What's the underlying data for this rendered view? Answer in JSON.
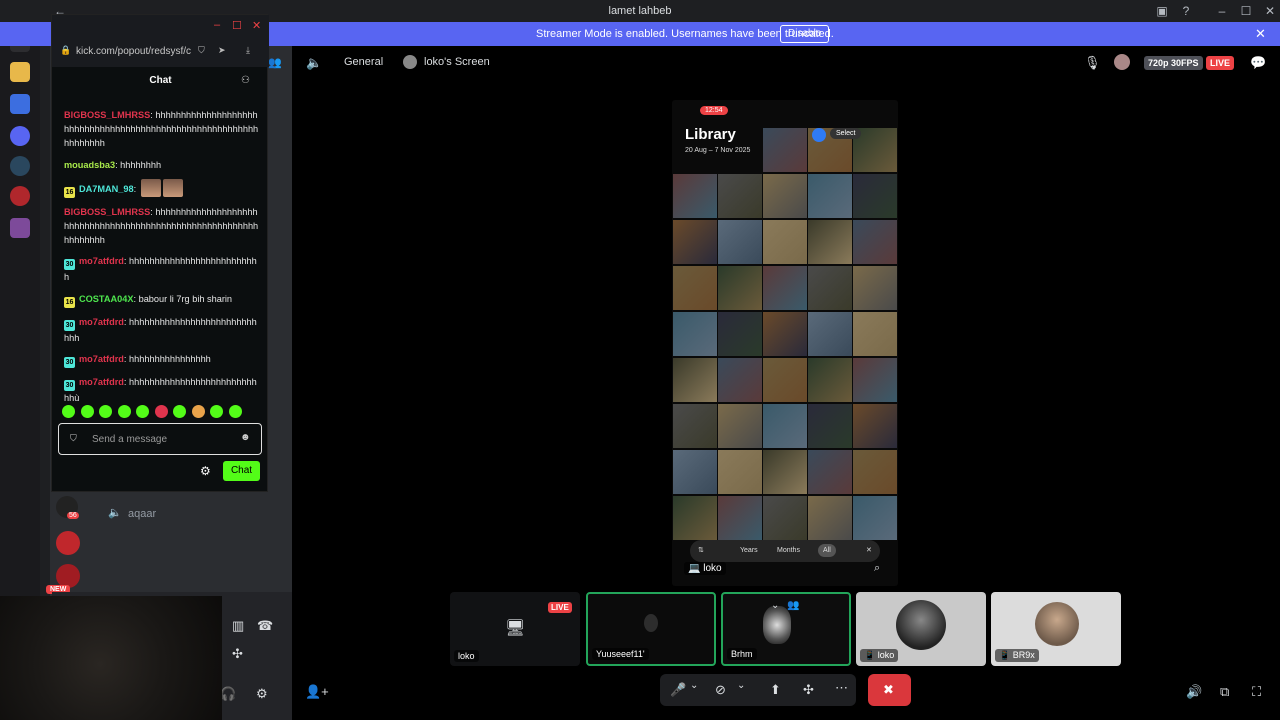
{
  "window": {
    "title": "lamet lahbeb"
  },
  "banner": {
    "text": "Streamer Mode is enabled. Usernames have been truncated.",
    "disable_label": "Disable"
  },
  "kick": {
    "url": "kick.com/popout/redsysf/c",
    "chat_title": "Chat",
    "messages": [
      {
        "user": "BIGBOSS_LMHRSS",
        "color": "#e0344d",
        "text": "hhhhhhhhhhhhhhhhhhhhhhhhhhhhhhhhhhhhhhhhhhhhhhhhhhhhhhhhhhhhhhhhhh"
      },
      {
        "user": "mouadsba3",
        "color": "#a8e94a",
        "text": "hhhhhhhh"
      },
      {
        "user": "DA7MAN_98",
        "color": "#4ee6d8",
        "badge": "16",
        "text": ""
      },
      {
        "user": "BIGBOSS_LMHRSS",
        "color": "#e0344d",
        "text": "hhhhhhhhhhhhhhhhhhhhhhhhhhhhhhhhhhhhhhhhhhhhhhhhhhhhhhhhhhhhhhhhhh"
      },
      {
        "user": "mo7atfdrd",
        "color": "#e0344d",
        "badge": "30",
        "text": "hhhhhhhhhhhhhhhhhhhhhhhhhh"
      },
      {
        "user": "COSTAA04X",
        "color": "#4ee64e",
        "badge": "16",
        "text": "babour li 7rg bih sharin"
      },
      {
        "user": "mo7atfdrd",
        "color": "#e0344d",
        "badge": "30",
        "text": "hhhhhhhhhhhhhhhhhhhhhhhhhhhh"
      },
      {
        "user": "mo7atfdrd",
        "color": "#e0344d",
        "badge": "30",
        "text": "hhhhhhhhhhhhhhhh"
      },
      {
        "user": "mo7atfdrd",
        "color": "#e0344d",
        "badge": "30",
        "text": "hhhhhhhhhhhhhhhhhhhhhhhhhhhù"
      }
    ],
    "send_placeholder": "Send a message",
    "chat_button": "Chat"
  },
  "voice": {
    "users": [
      "aqaar"
    ],
    "badge_count": "56",
    "new_label": "NEW"
  },
  "stage": {
    "channel": "General",
    "screen_title": "loko's Screen",
    "quality": "720p 30FPS",
    "live": "LIVE",
    "stream_owner": "loko",
    "phone": {
      "time": "12:54",
      "title": "Library",
      "date": "20 Aug – 7 Nov 2025",
      "select": "Select",
      "tabs": [
        "Years",
        "Months",
        "All"
      ]
    }
  },
  "tiles": [
    {
      "name": "loko",
      "live": "LIVE"
    },
    {
      "name": "Yuuseeef11'"
    },
    {
      "name": "Brhm"
    },
    {
      "name": "loko"
    },
    {
      "name": "BR9x"
    }
  ]
}
